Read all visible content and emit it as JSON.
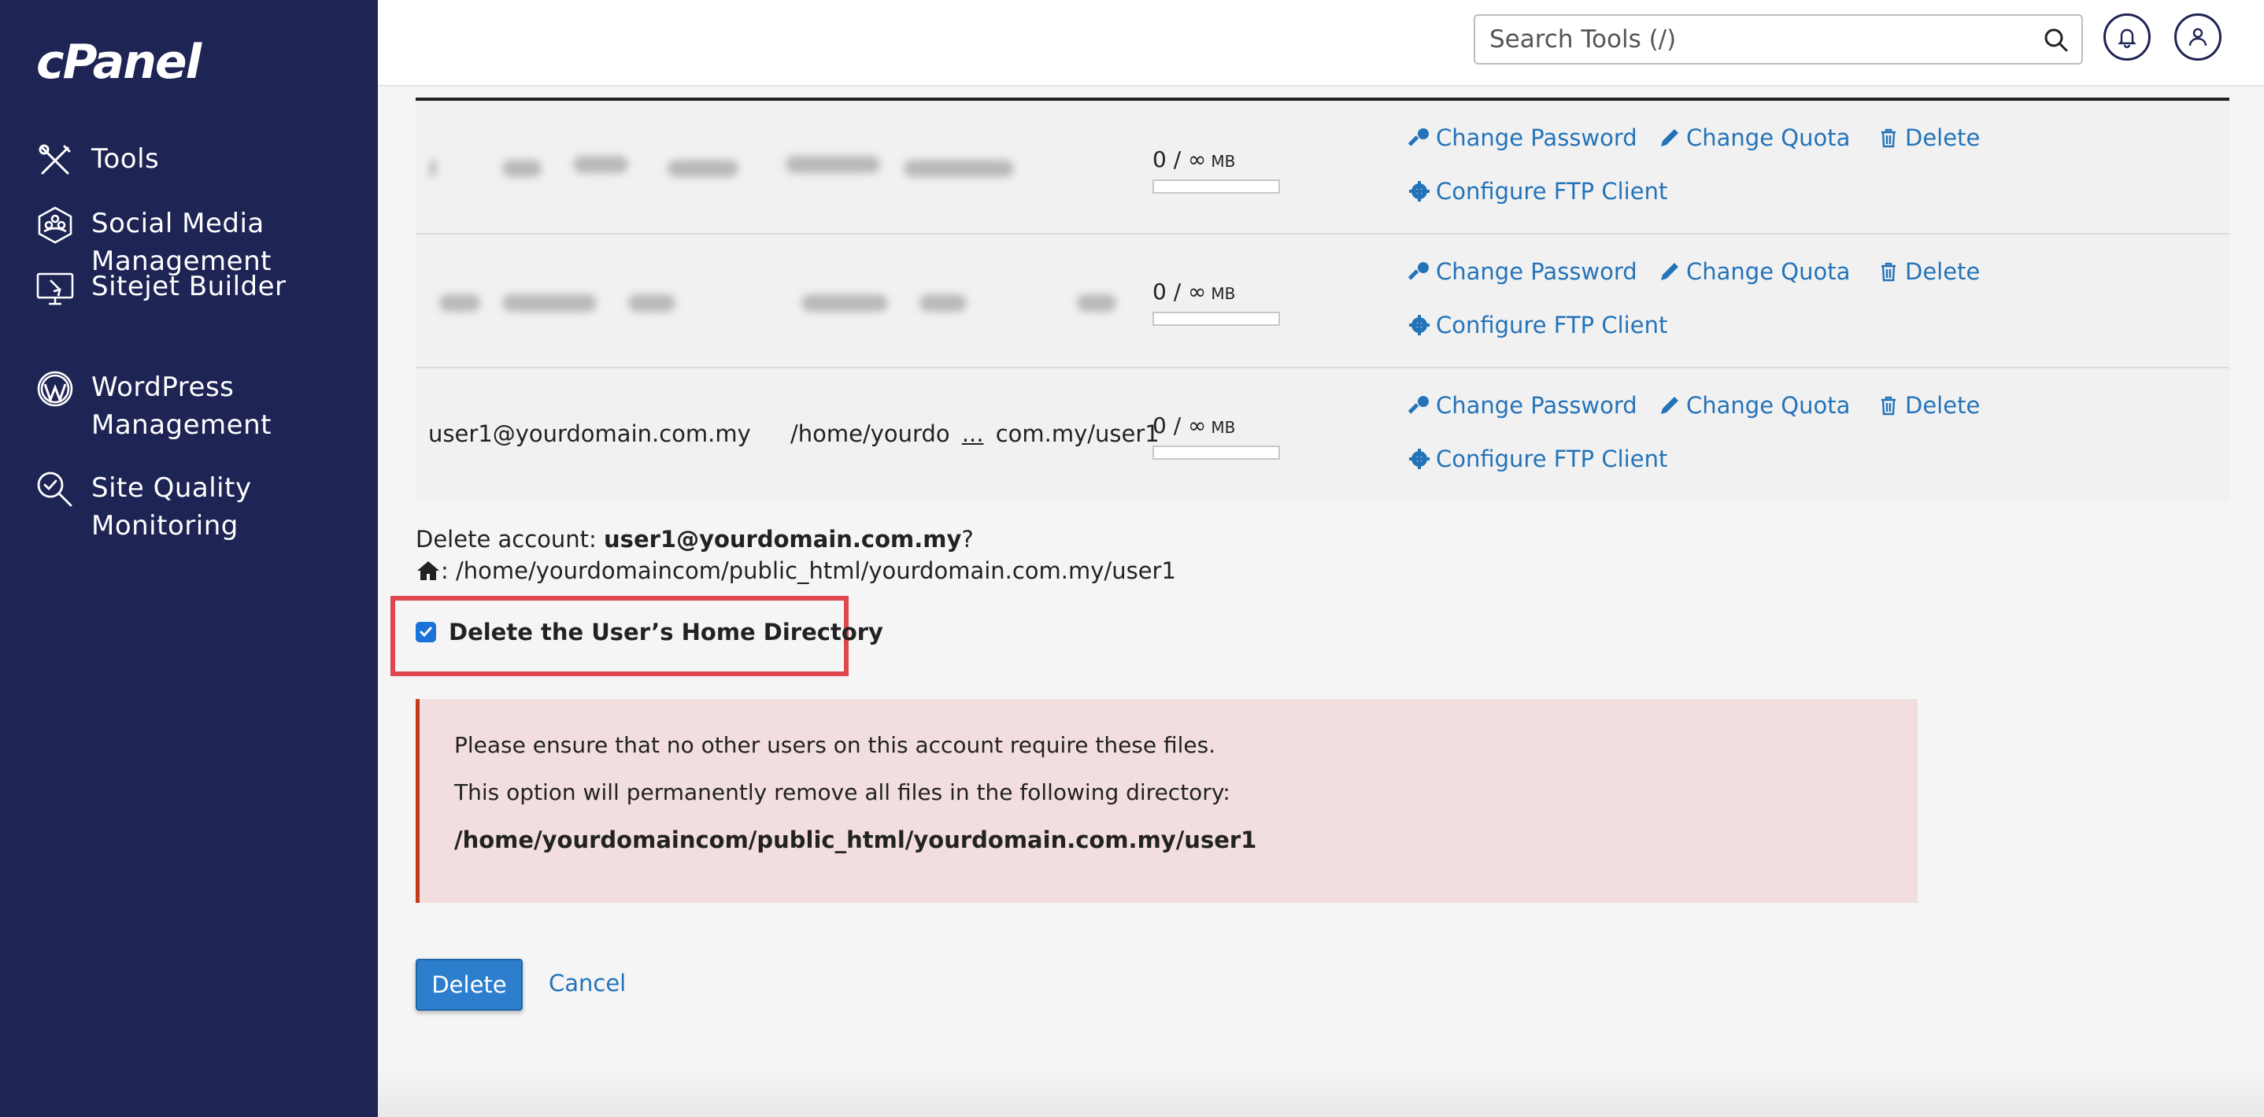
{
  "brand": {
    "logo": "cPanel"
  },
  "sidebar": {
    "items": [
      {
        "label": "Tools",
        "icon": "tools-icon"
      },
      {
        "label": "Social Media Management",
        "icon": "social-media-icon"
      },
      {
        "label": "Sitejet Builder",
        "icon": "sitejet-icon"
      },
      {
        "label": "WordPress Management",
        "icon": "wordpress-icon"
      },
      {
        "label": "Site Quality Monitoring",
        "icon": "site-quality-icon"
      }
    ]
  },
  "header": {
    "search_placeholder": "Search Tools (/)",
    "icons": [
      "search-icon",
      "bell-icon",
      "user-icon"
    ]
  },
  "table": {
    "rows": [
      {
        "user": "",
        "directory": "",
        "quota_used": "0 / ∞",
        "quota_unit": "MB",
        "blurred": true
      },
      {
        "user": "",
        "directory": "",
        "quota_used": "0 / ∞",
        "quota_unit": "MB",
        "blurred": true
      },
      {
        "user": "user1@yourdomain.com.my",
        "directory": "/home/yourdo",
        "directory_ellipsis": "...",
        "directory_end": "com.my/user1",
        "quota_used": "0 / ∞",
        "quota_unit": "MB",
        "blurred": false
      }
    ],
    "actions": {
      "change_password": "Change Password",
      "change_quota": "Change Quota",
      "delete": "Delete",
      "configure_ftp": "Configure FTP Client"
    }
  },
  "confirm": {
    "prefix": "Delete account: ",
    "account": "user1@yourdomain.com.my",
    "suffix": "?",
    "home_path": ": /home/yourdomaincom/public_html/yourdomain.com.my/user1",
    "checkbox_label": "Delete the User’s Home Directory",
    "checkbox_checked": true
  },
  "alert": {
    "line1": "Please ensure that no other users on this account require these files.",
    "line2": "This option will permanently remove all files in the following directory:",
    "path": "/home/yourdomaincom/public_html/yourdomain.com.my/user1"
  },
  "buttons": {
    "delete": "Delete",
    "cancel": "Cancel"
  },
  "colors": {
    "sidebar_bg": "#1e2454",
    "link": "#2473b9",
    "primary": "#2d7fce",
    "alert_bg": "#f2dede",
    "alert_border": "#c43a1a",
    "highlight": "#e0474c"
  }
}
